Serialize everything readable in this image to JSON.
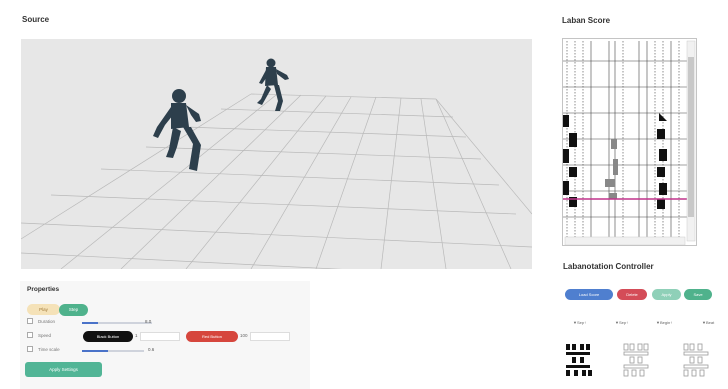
{
  "source": {
    "title": "Source"
  },
  "laban": {
    "title": "Laban Score"
  },
  "controller": {
    "title": "Labanotation Controller",
    "buttons": [
      "Load Score",
      "Delete",
      "Apply",
      "Save"
    ],
    "labels": [
      "▼Sep↑",
      "▼Sep↑",
      "▼Begin↑",
      "▼Beat"
    ]
  },
  "properties": {
    "title": "Properties",
    "play_label": "Play",
    "step_label": "Step",
    "rows": [
      {
        "label": "Duration",
        "value": "8.0"
      },
      {
        "label": "Speed",
        "value": "1"
      },
      {
        "label": "Time scale",
        "value": "0.6"
      }
    ],
    "black_button": "Black Button",
    "red_button": "Red Button",
    "red_value": "100",
    "bottom_button": "Apply Settings"
  },
  "colors": {
    "blue": "#4f7fcf",
    "red": "#d44c58",
    "green": "#4fb28c",
    "light_green": "#8fd0b8",
    "magenta_line": "#c0338c"
  }
}
